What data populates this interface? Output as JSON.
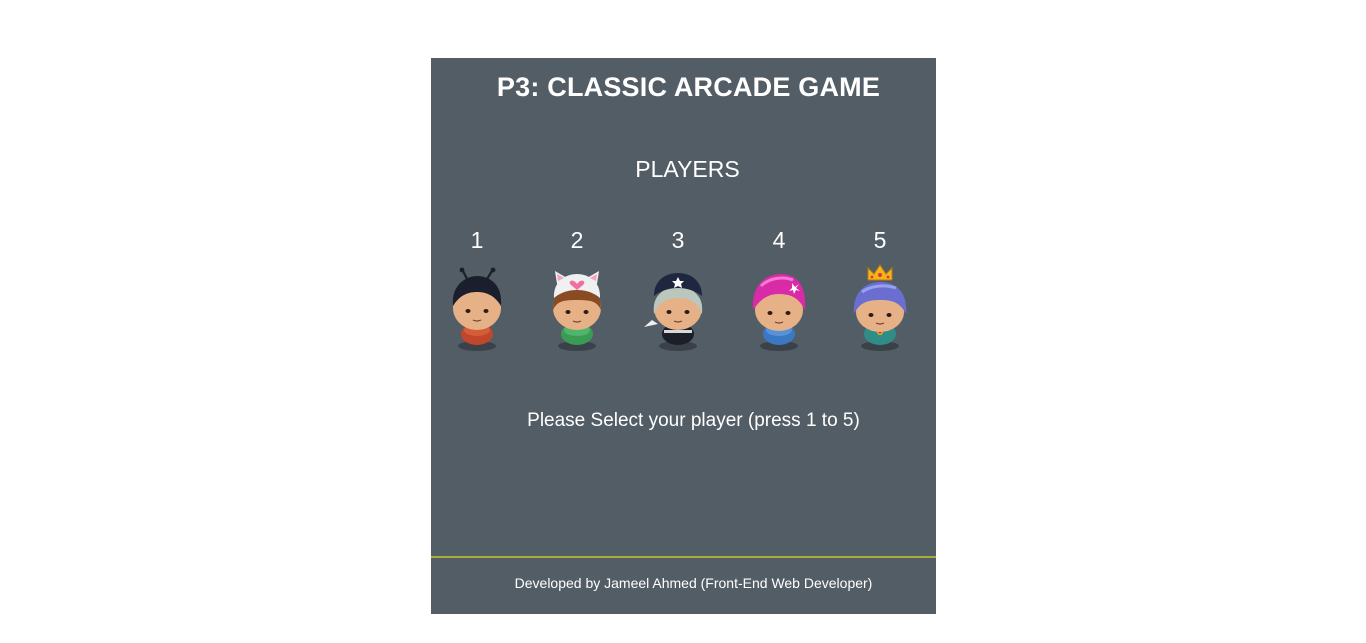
{
  "header": {
    "title": "P3: CLASSIC ARCADE GAME"
  },
  "players_section": {
    "heading": "PLAYERS",
    "players": [
      {
        "number": "1",
        "icon": "boy-avatar-icon"
      },
      {
        "number": "2",
        "icon": "cat-hat-girl-avatar-icon"
      },
      {
        "number": "3",
        "icon": "pirate-avatar-icon"
      },
      {
        "number": "4",
        "icon": "pink-hair-girl-avatar-icon"
      },
      {
        "number": "5",
        "icon": "princess-avatar-icon"
      }
    ],
    "instruction": "Please Select your player (press 1 to 5)"
  },
  "footer": {
    "credit": "Developed by Jameel Ahmed (Front-End Web Developer)"
  },
  "colors": {
    "panel": "#535d66",
    "text": "#ffffff",
    "divider": "#a8b03a"
  }
}
